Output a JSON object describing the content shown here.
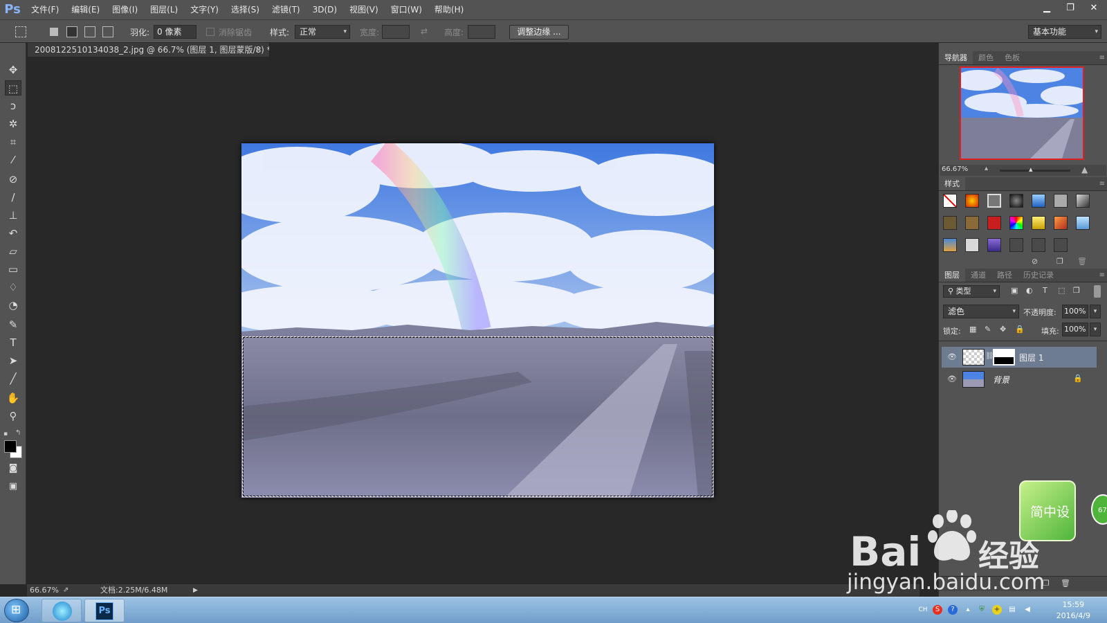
{
  "app": {
    "logo": "Ps"
  },
  "menu": [
    "文件(F)",
    "编辑(E)",
    "图像(I)",
    "图层(L)",
    "文字(Y)",
    "选择(S)",
    "滤镜(T)",
    "3D(D)",
    "视图(V)",
    "窗口(W)",
    "帮助(H)"
  ],
  "window_controls": {
    "minimize": "▁",
    "restore": "❐",
    "close": "✕"
  },
  "options": {
    "feather_label": "羽化:",
    "feather_value": "0 像素",
    "antialias_label": "消除锯齿",
    "style_label": "样式:",
    "style_value": "正常",
    "width_label": "宽度:",
    "height_label": "高度:",
    "refine_edge_button": "调整边缘 ...",
    "workspace_value": "基本功能"
  },
  "document": {
    "tab_title": "2008122510134038_2.jpg @ 66.7% (图层 1, 图层蒙版/8) *",
    "close_glyph": "×"
  },
  "status": {
    "zoom": "66.67%",
    "doc_size": "文档:2.25M/6.48M"
  },
  "panels": {
    "navigator_tabs": [
      "导航器",
      "颜色",
      "色板"
    ],
    "navigator_zoom": "66.67%",
    "styles_tab": "样式",
    "layers_tabs": [
      "图层",
      "通道",
      "路径",
      "历史记录"
    ],
    "filter_kind": "类型",
    "blend_mode": "滤色",
    "opacity_label": "不透明度:",
    "opacity_value": "100%",
    "lock_label": "锁定:",
    "fill_label": "填充:",
    "fill_value": "100%",
    "layers": [
      {
        "name": "图层 1",
        "selected": true
      },
      {
        "name": "背景",
        "locked": true
      }
    ]
  },
  "taskbar": {
    "lang": "CH",
    "time": "15:59",
    "date": "2016/4/9",
    "ps_label": "Ps"
  },
  "watermark": {
    "brand": "Bai",
    "brand2": "经验",
    "url": "jingyan.baidu.com",
    "badge_text": "简中设"
  },
  "colors": {
    "panel_bg": "#535353",
    "canvas_bg": "#282828",
    "selected_layer": "#6e7c91",
    "nav_frame": "#e02020"
  }
}
